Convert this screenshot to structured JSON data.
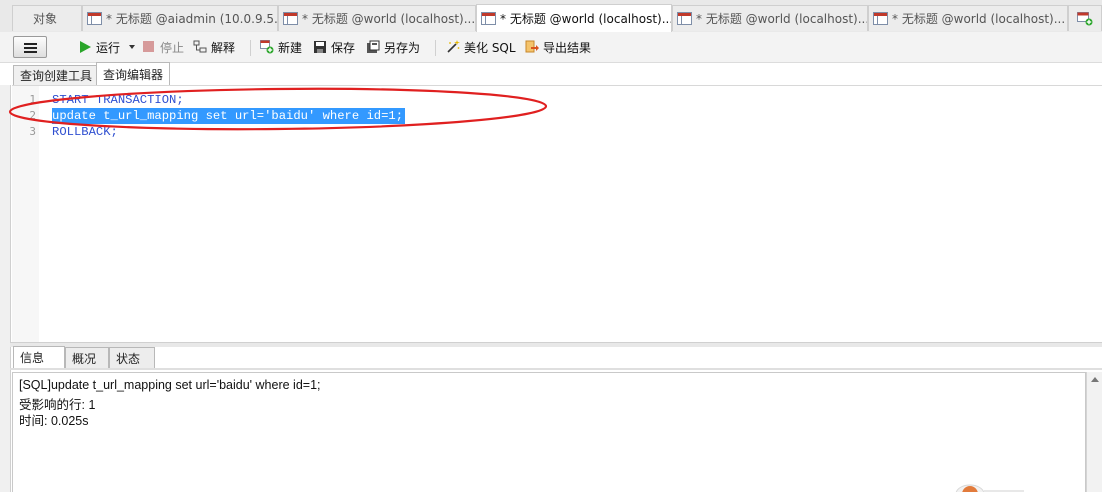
{
  "tabs": [
    {
      "label": "对象",
      "active": false,
      "icon": "none"
    },
    {
      "label": "* 无标题 @aiadmin (10.0.9.5...",
      "active": false,
      "icon": "query-table-icon"
    },
    {
      "label": "* 无标题 @world (localhost)...",
      "active": false,
      "icon": "query-table-icon"
    },
    {
      "label": "* 无标题 @world (localhost)...",
      "active": true,
      "icon": "query-table-icon"
    },
    {
      "label": "* 无标题 @world (localhost)...",
      "active": false,
      "icon": "query-table-icon"
    },
    {
      "label": "* 无标题 @world (localhost)...",
      "active": false,
      "icon": "query-table-icon"
    }
  ],
  "toolbar": {
    "run": "运行",
    "stop": "停止",
    "explain": "解释",
    "new": "新建",
    "save": "保存",
    "save_as": "另存为",
    "beautify": "美化 SQL",
    "export": "导出结果"
  },
  "editor_tabs": {
    "builder": "查询创建工具",
    "editor": "查询编辑器"
  },
  "code_lines": [
    {
      "num": "1",
      "text": "START TRANSACTION;",
      "selected": false
    },
    {
      "num": "2",
      "text": "update t_url_mapping set url='baidu' where id=1;",
      "selected": true
    },
    {
      "num": "3",
      "text": "ROLLBACK;",
      "selected": false
    }
  ],
  "bottom_tabs": {
    "info": "信息",
    "overview": "概况",
    "status": "状态"
  },
  "output_lines": [
    "[SQL]update t_url_mapping set url='baidu' where id=1;",
    "受影响的行: 1",
    "时间: 0.025s"
  ],
  "colors": {
    "accent_annotation": "#e02020",
    "selection": "#3399ff",
    "sql_keyword": "#2f4fd0",
    "run_green": "#2aa52a"
  }
}
